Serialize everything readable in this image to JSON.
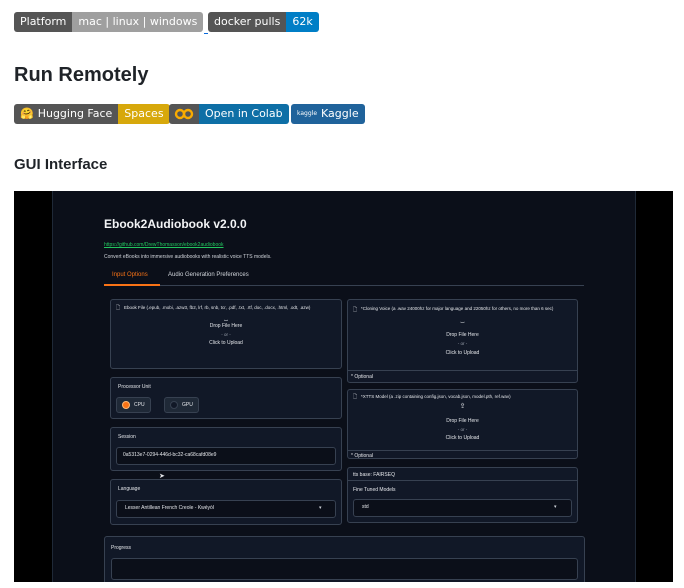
{
  "badges": {
    "platform_label": "Platform",
    "platform_value": "mac | linux | windows",
    "docker_label": "docker pulls",
    "docker_value": "62k",
    "hf_label": "Hugging Face",
    "hf_value": "Spaces",
    "colab_label": "Open in Colab",
    "kaggle_label": "Kaggle"
  },
  "headings": {
    "run_remotely": "Run Remotely",
    "gui_interface": "GUI Interface"
  },
  "app": {
    "title": "Ebook2Audiobook v2.0.0",
    "link": "https://github.com/DrewThomasson/ebook2audiobook",
    "description": "Convert eBooks into immersive audiobooks with realistic voice TTS models.",
    "tabs": [
      "Input Options",
      "Audio Generation Preferences"
    ],
    "ebook_file": {
      "label": "Ebook File (.epub, .mobi, .azw3, fb2, lrf, rb, snb, tcr, .pdf, .txt, .rtf, doc, .docx, .html, .odt, .azw)",
      "drop": "Drop File Here",
      "or": "- or -",
      "click": "Click to Upload"
    },
    "cloning_voice": {
      "label": "*Cloning Voice (a .wav 24000hz for major language and 22050hz for others, no more than 6 sec)",
      "drop": "Drop File Here",
      "or": "- or -",
      "click": "Click to Upload",
      "optional": "* Optional"
    },
    "processor": {
      "label": "Processor Unit",
      "cpu": "CPU",
      "gpu": "GPU"
    },
    "xtts_model": {
      "label": "*XTTS Model (a .zip containing config.json, vocab.json, model.pth, ref.wav)",
      "drop": "Drop File Here",
      "or": "- or -",
      "click": "Click to Upload",
      "optional": "* Optional"
    },
    "session": {
      "label": "Session",
      "value": "0a5313e7-0294-446d-bc32-ca68cafd08e9"
    },
    "tts_base": "tts base: FAIRSEQ",
    "fine_tuned": {
      "label": "Fine Tuned Models",
      "value": "std"
    },
    "language": {
      "label": "Language",
      "value": "Lesser Antillean French Creole - Kwéyòl"
    },
    "progress": {
      "label": "Progress"
    }
  },
  "colors": {
    "accent": "#f97316",
    "link_green": "#22c55e",
    "app_bg": "#0b0f19",
    "badge_blue": "#007ec6"
  }
}
